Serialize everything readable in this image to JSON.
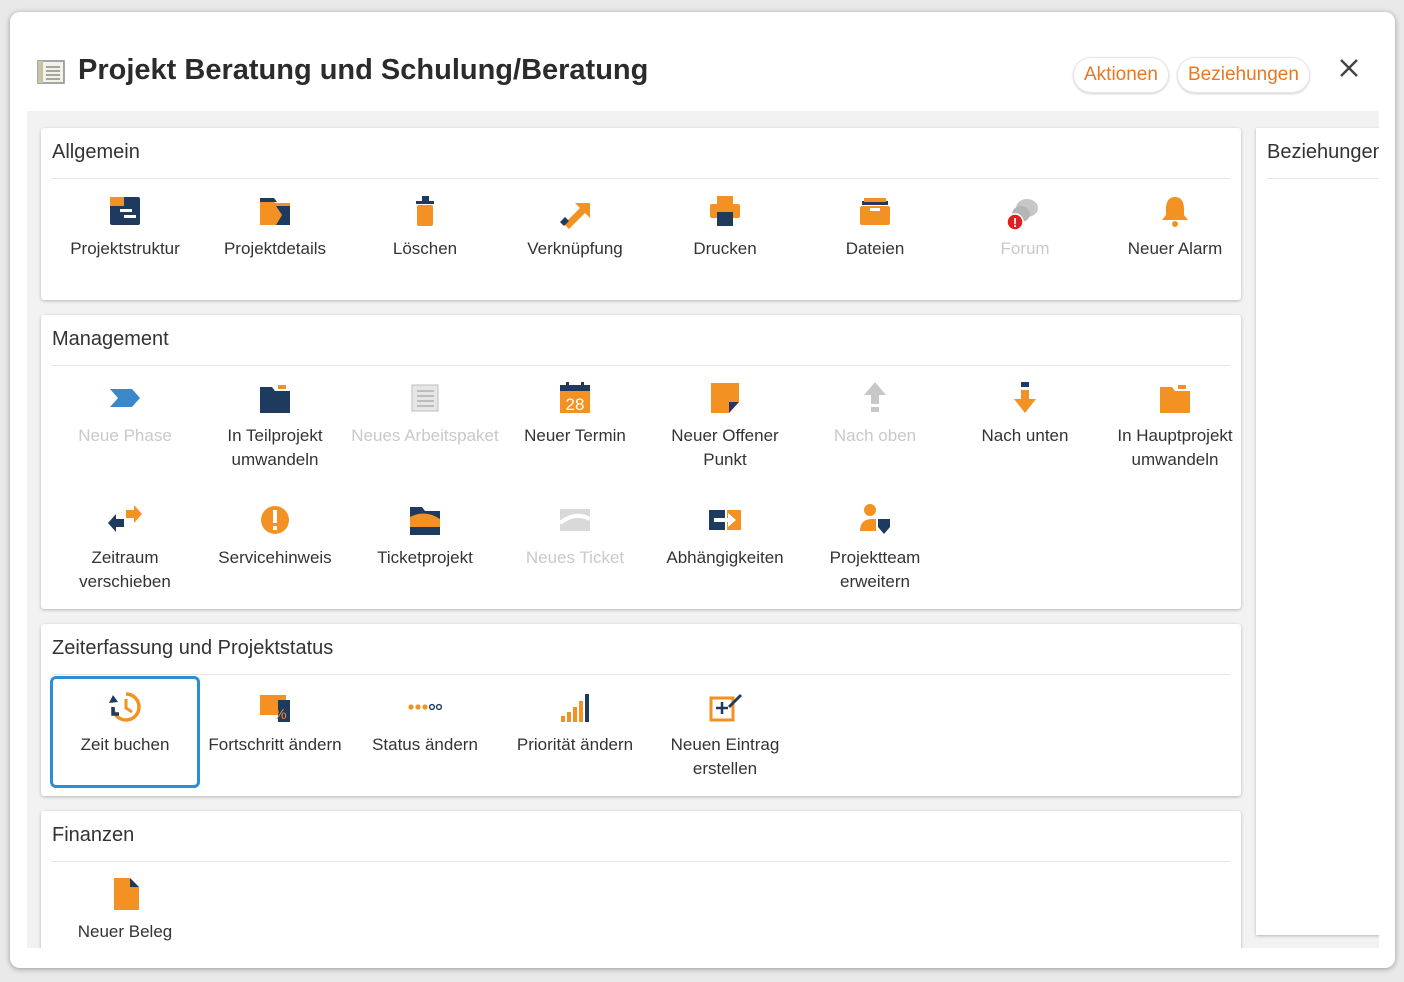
{
  "dialog": {
    "title": "Projekt Beratung und Schulung/Beratung",
    "actions_label": "Aktionen",
    "relations_label": "Beziehungen"
  },
  "colors": {
    "accent": "#e87722",
    "icon_orange": "#f39223",
    "icon_navy": "#1f3a5f",
    "icon_blue": "#3a87c9",
    "disabled": "#c9c9c9",
    "selected_border": "#2b8fd6",
    "alert_red": "#e02020"
  },
  "sections": {
    "allgemein": {
      "title": "Allgemein",
      "items": [
        {
          "label": "Projektstruktur",
          "icon": "project-structure-icon"
        },
        {
          "label": "Projektdetails",
          "icon": "project-details-icon"
        },
        {
          "label": "Löschen",
          "icon": "trash-icon"
        },
        {
          "label": "Verknüpfung",
          "icon": "link-arrow-icon"
        },
        {
          "label": "Drucken",
          "icon": "printer-icon"
        },
        {
          "label": "Dateien",
          "icon": "files-icon"
        },
        {
          "label": "Forum",
          "icon": "forum-icon",
          "disabled": true,
          "alert": "!"
        },
        {
          "label": "Neuer Alarm",
          "icon": "bell-icon"
        }
      ]
    },
    "management": {
      "title": "Management",
      "items": [
        {
          "label": "Neue Phase",
          "icon": "phase-icon",
          "disabled": true
        },
        {
          "label": "In Teilprojekt umwandeln",
          "icon": "folder-navy-icon"
        },
        {
          "label": "Neues Arbeitspaket",
          "icon": "work-package-icon",
          "disabled": true
        },
        {
          "label": "Neuer Termin",
          "icon": "calendar-icon",
          "day": "28"
        },
        {
          "label": "Neuer Offener Punkt",
          "icon": "sticky-note-icon"
        },
        {
          "label": "Nach oben",
          "icon": "arrow-up-icon",
          "disabled": true
        },
        {
          "label": "Nach unten",
          "icon": "arrow-down-icon"
        },
        {
          "label": "In Hauptprojekt umwandeln",
          "icon": "folder-orange-icon"
        },
        {
          "label": "Zeitraum verschieben",
          "icon": "shift-arrows-icon"
        },
        {
          "label": "Servicehinweis",
          "icon": "service-alert-icon"
        },
        {
          "label": "Ticketprojekt",
          "icon": "ticket-folder-icon"
        },
        {
          "label": "Neues Ticket",
          "icon": "ticket-icon",
          "disabled": true
        },
        {
          "label": "Abhängigkeiten",
          "icon": "dependencies-icon"
        },
        {
          "label": "Projektteam erweitern",
          "icon": "team-icon"
        }
      ]
    },
    "zeit": {
      "title": "Zeiterfassung und Projektstatus",
      "items": [
        {
          "label": "Zeit buchen",
          "icon": "clock-history-icon",
          "selected": true
        },
        {
          "label": "Fortschritt ändern",
          "icon": "progress-icon"
        },
        {
          "label": "Status ändern",
          "icon": "status-dots-icon"
        },
        {
          "label": "Priorität ändern",
          "icon": "priority-bars-icon"
        },
        {
          "label": "Neuen Eintrag erstellen",
          "icon": "new-entry-icon"
        }
      ]
    },
    "finanzen": {
      "title": "Finanzen",
      "items": [
        {
          "label": "Neuer Beleg",
          "icon": "document-icon"
        }
      ]
    }
  },
  "side_panel": {
    "title": "Beziehungen"
  }
}
